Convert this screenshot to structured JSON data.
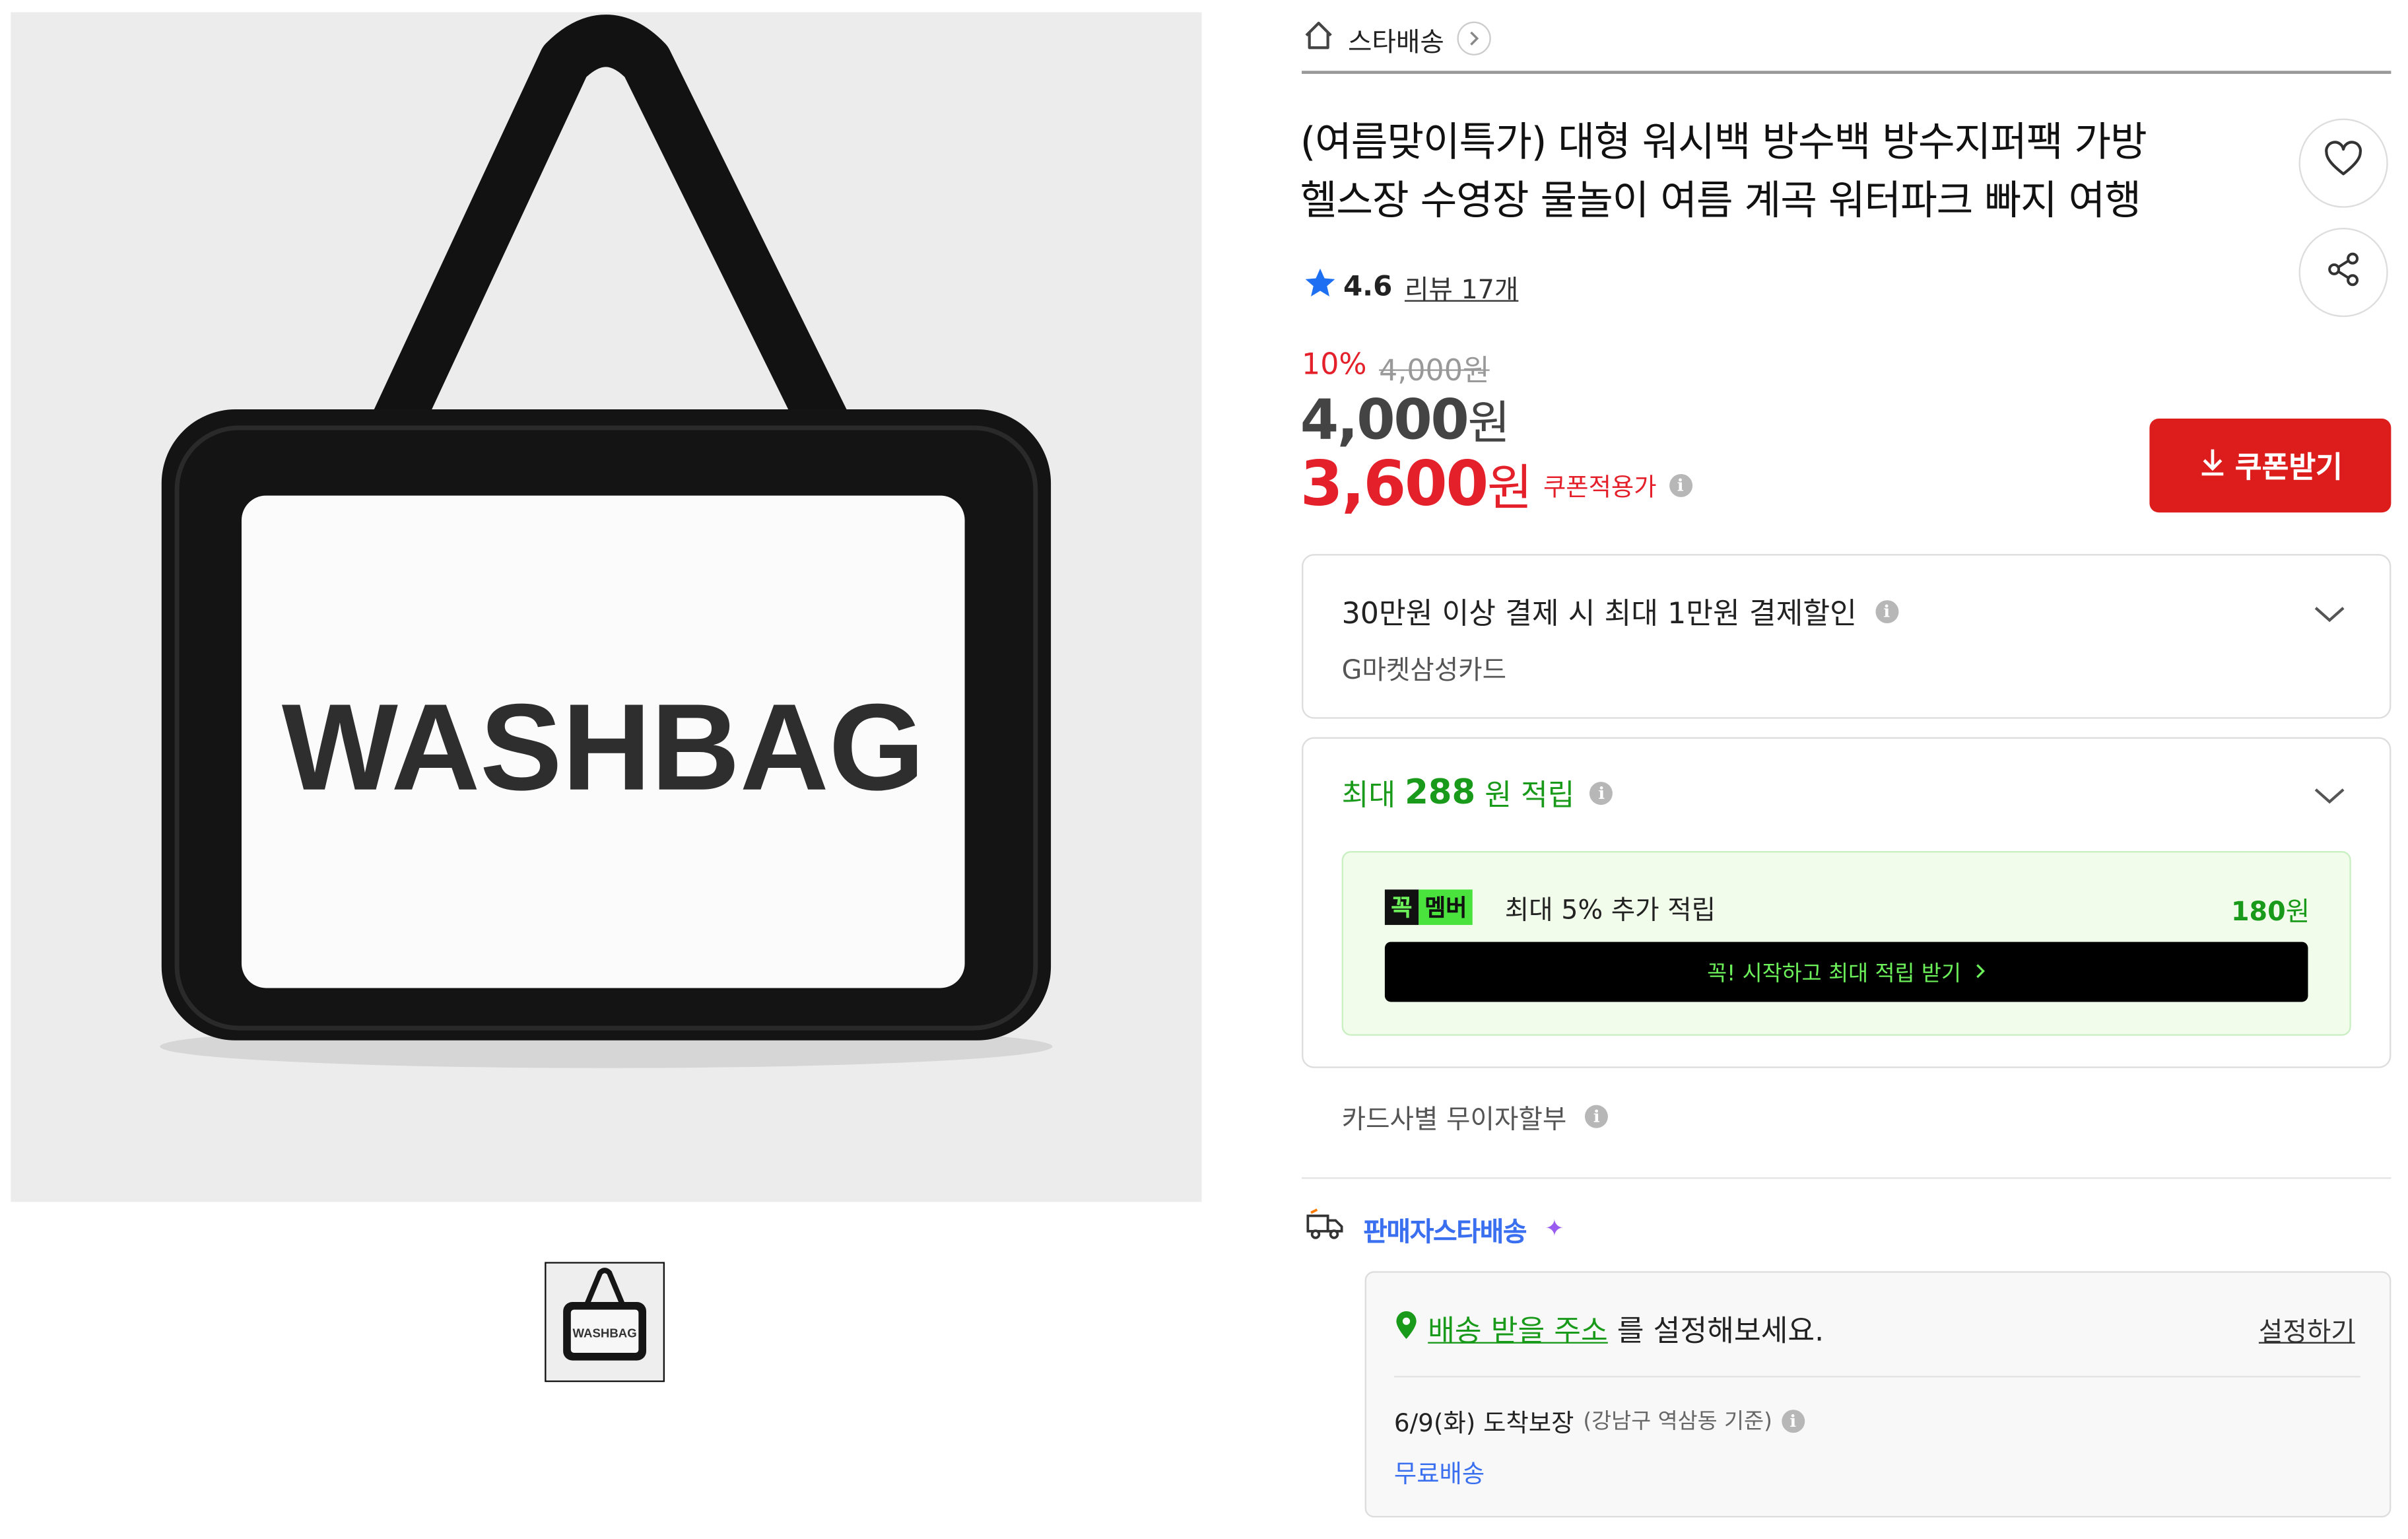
{
  "product": {
    "image_text": "WASHBAG",
    "thumbnail_text": "WASHBAG",
    "title_line1": "(여름맞이특가) 대형 워시백 방수백 방수지퍼팩 가방",
    "title_line2": "헬스장 수영장 물놀이 여름 계곡 워터파크 빠지 여행"
  },
  "breadcrumb": {
    "label": "스타배송"
  },
  "rating": {
    "score": "4.6",
    "review_link": "리뷰 17개"
  },
  "price": {
    "discount_rate": "10%",
    "original": "4,000원",
    "sale_amount": "4,000",
    "coupon_amount": "3,600",
    "currency": "원",
    "coupon_label": "쿠폰적용가",
    "coupon_button": "쿠폰받기"
  },
  "card_discount": {
    "title": "30만원 이상 결제 시 최대 1만원 결제할인",
    "card_name": "G마켓삼성카드"
  },
  "points": {
    "prefix": "최대",
    "amount": "288",
    "unit": "원",
    "suffix": "적립",
    "member_badge_left": "꼭",
    "member_badge_right": "멤버",
    "member_text": "최대 5% 추가 적립",
    "member_amount": "180",
    "member_button": "꼭! 시작하고 최대 적립 받기"
  },
  "installment": {
    "label": "카드사별 무이자할부"
  },
  "shipping": {
    "label": "판매자스타배송",
    "address_link": "배송 받을 주소",
    "address_suffix": "를 설정해보세요.",
    "set_link": "설정하기",
    "eta": "6/9(화) 도착보장",
    "eta_note": "(강남구 역삼동 기준)",
    "free": "무료배송"
  },
  "colors": {
    "accent_red": "#dd1c1c",
    "price_red": "#e4202a",
    "points_green": "#1a9a1a",
    "ship_blue": "#3a6ff0"
  },
  "icons": [
    "home-icon",
    "chevron-right-icon",
    "heart-icon",
    "share-icon",
    "star-icon",
    "info-icon",
    "download-icon",
    "chevron-down-icon",
    "truck-icon",
    "location-pin-icon"
  ]
}
